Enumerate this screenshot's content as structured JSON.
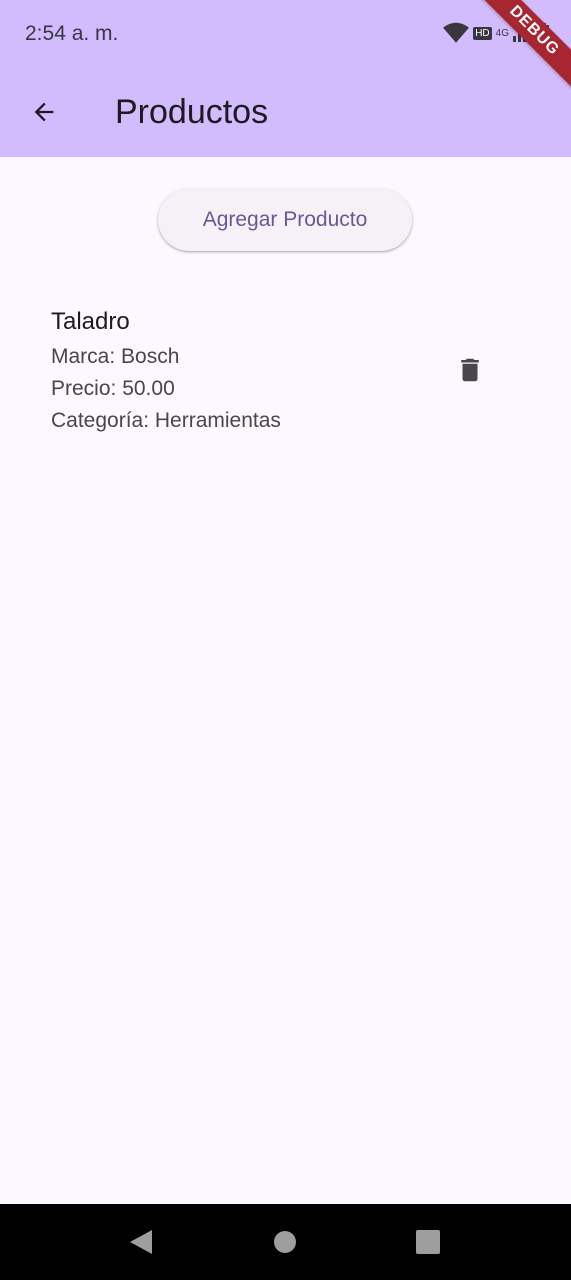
{
  "status_bar": {
    "time": "2:54 a. m.",
    "network_label": "4G",
    "hd_label": "HD"
  },
  "debug_banner": "DEBUG",
  "app_bar": {
    "title": "Productos",
    "back_icon": "arrow-left-icon"
  },
  "actions": {
    "add_label": "Agregar Producto"
  },
  "products": [
    {
      "name": "Taladro",
      "marca": "Marca: Bosch",
      "precio": "Precio: 50.00",
      "categoria": "Categoría: Herramientas"
    }
  ],
  "colors": {
    "app_bar": "#d3bcfd",
    "background": "#fdf7ff",
    "button_text": "#6b5796",
    "delete_icon": "#49454f"
  }
}
